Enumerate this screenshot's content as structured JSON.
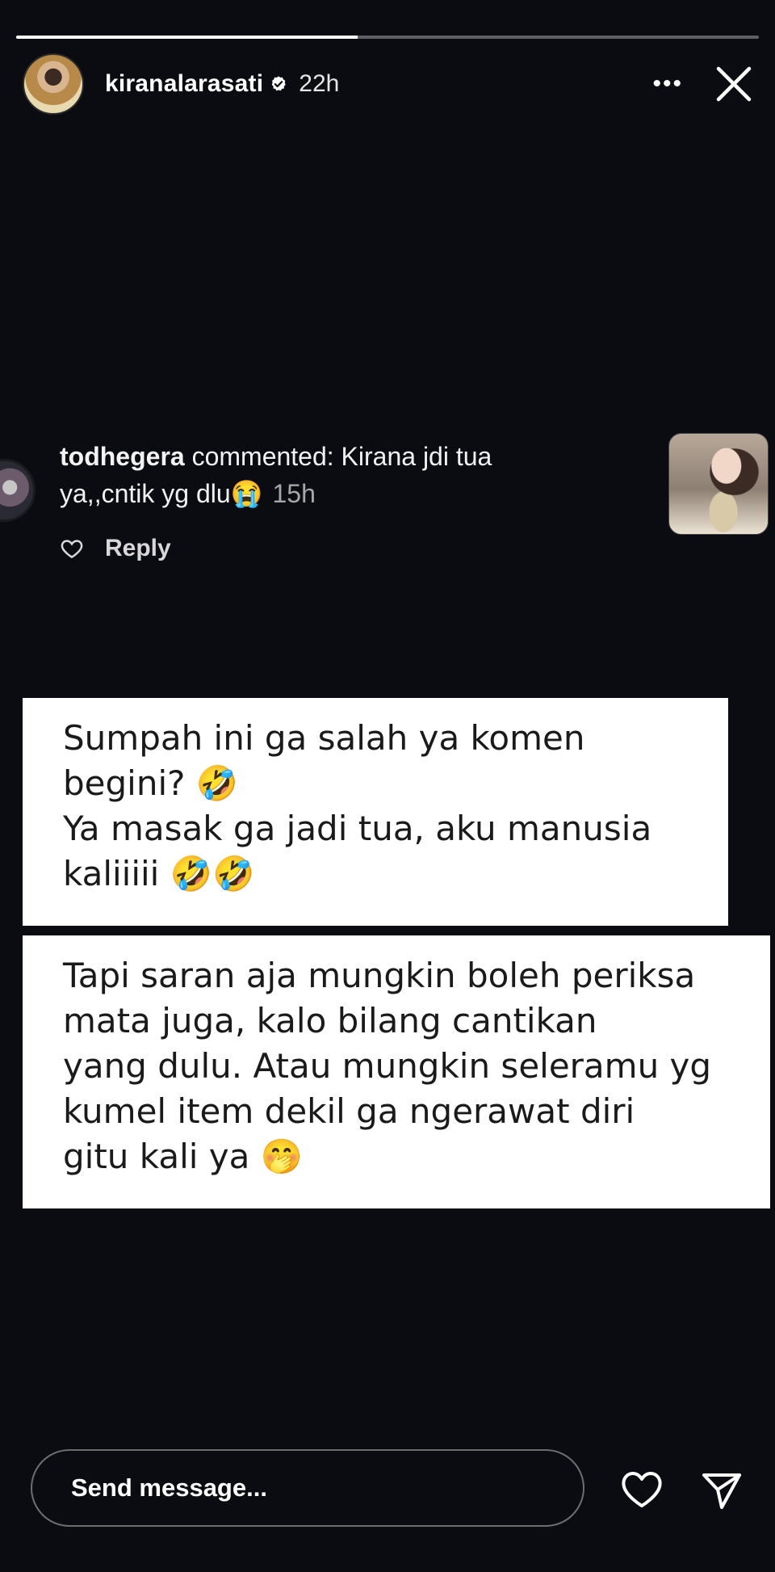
{
  "story": {
    "progress": 0.46,
    "username": "kiranalarasati",
    "verified": true,
    "time": "22h",
    "more_icon": "more-horizontal-icon",
    "close_icon": "close-icon"
  },
  "comment": {
    "username": "todhegera",
    "action": "commented:",
    "text_line1": "Kirana jdi tua",
    "text_line2": "ya,,cntik yg dlu😭",
    "time": "15h",
    "reply_label": "Reply",
    "like_icon": "heart-outline-icon"
  },
  "overlay_text_1": {
    "lines": [
      "Sumpah ini ga salah ya komen",
      "begini? 🤣",
      "Ya masak ga jadi tua, aku manusia",
      "kaliiiii 🤣🤣"
    ]
  },
  "overlay_text_2": {
    "lines": [
      "Tapi saran aja mungkin boleh periksa",
      "mata juga, kalo bilang cantikan",
      "yang dulu. Atau mungkin seleramu yg",
      "kumel item dekil ga ngerawat diri",
      "gitu kali ya 🤭"
    ]
  },
  "footer": {
    "message_placeholder": "Send message...",
    "like_icon": "heart-outline-icon",
    "send_icon": "paper-plane-icon"
  },
  "colors": {
    "background": "#0b0c12",
    "text_box": "#ffffff",
    "text_dark": "#1a1a1a"
  }
}
